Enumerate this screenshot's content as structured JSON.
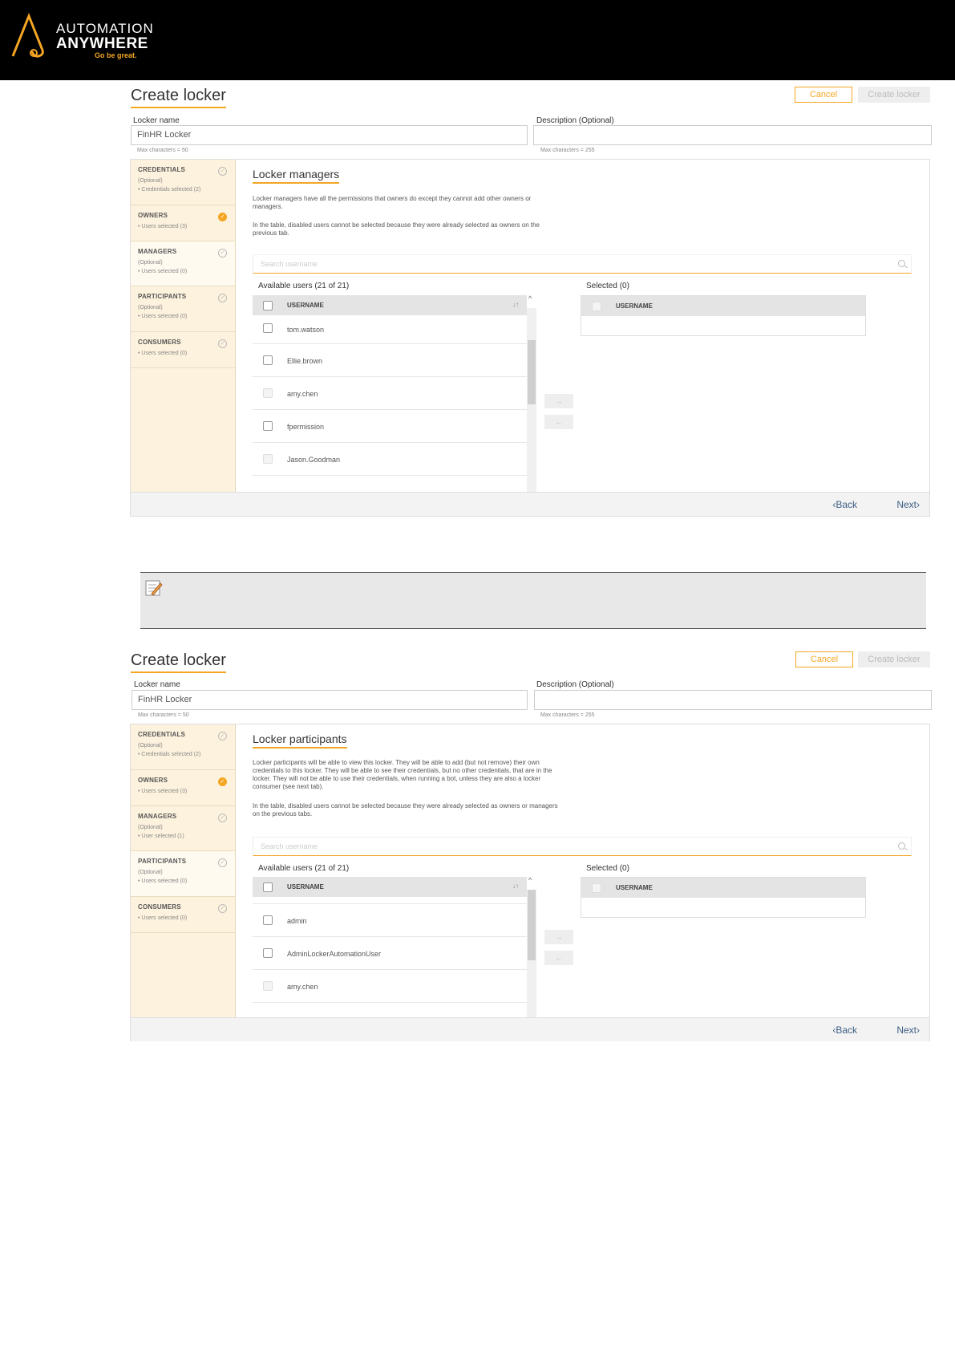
{
  "brand": {
    "line1": "AUTOMATION",
    "line2": "ANYWHERE",
    "tagline": "Go be great."
  },
  "panels": [
    {
      "title": "Create locker",
      "cancel_label": "Cancel",
      "create_label": "Create locker",
      "locker_name_label": "Locker name",
      "locker_name_value": "FinHR Locker",
      "locker_name_hint": "Max characters = 50",
      "description_label": "Description (Optional)",
      "description_value": "",
      "description_hint": "Max characters = 255",
      "steps": [
        {
          "name": "CREDENTIALS",
          "sub1": "(Optional)",
          "sub2": "• Credentials selected (2)",
          "done": false
        },
        {
          "name": "OWNERS",
          "sub1": "",
          "sub2": "• Users selected (3)",
          "done": true
        },
        {
          "name": "MANAGERS",
          "sub1": "(Optional)",
          "sub2": "• Users selected (0)",
          "done": false
        },
        {
          "name": "PARTICIPANTS",
          "sub1": "(Optional)",
          "sub2": "• Users selected (0)",
          "done": false
        },
        {
          "name": "CONSUMERS",
          "sub1": "",
          "sub2": "• Users selected (0)",
          "done": false
        }
      ],
      "section_title": "Locker managers",
      "desc1": "Locker managers have all the permissions that owners do except they cannot add other owners or managers.",
      "desc2": "In the table, disabled users cannot be selected because they were already selected as owners on the previous tab.",
      "search_placeholder": "Search username",
      "available_label": "Available users (21 of 21)",
      "selected_label": "Selected (0)",
      "column_username": "USERNAME",
      "users": [
        {
          "name": "tom.watson",
          "disabled": false
        },
        {
          "name": "Ellie.brown",
          "disabled": false
        },
        {
          "name": "amy.chen",
          "disabled": true
        },
        {
          "name": "fpermission",
          "disabled": false
        },
        {
          "name": "Jason.Goodman",
          "disabled": true
        }
      ],
      "move_right": "→",
      "move_left": "←",
      "back_label": "Back",
      "next_label": "Next"
    },
    {
      "title": "Create locker",
      "cancel_label": "Cancel",
      "create_label": "Create locker",
      "locker_name_label": "Locker name",
      "locker_name_value": "FinHR Locker",
      "locker_name_hint": "Max characters = 50",
      "description_label": "Description (Optional)",
      "description_value": "",
      "description_hint": "Max characters = 255",
      "steps": [
        {
          "name": "CREDENTIALS",
          "sub1": "(Optional)",
          "sub2": "• Credentials selected (2)",
          "done": false
        },
        {
          "name": "OWNERS",
          "sub1": "",
          "sub2": "• Users selected (3)",
          "done": true
        },
        {
          "name": "MANAGERS",
          "sub1": "(Optional)",
          "sub2": "• User selected (1)",
          "done": false
        },
        {
          "name": "PARTICIPANTS",
          "sub1": "(Optional)",
          "sub2": "• Users selected (0)",
          "done": false
        },
        {
          "name": "CONSUMERS",
          "sub1": "",
          "sub2": "• Users selected (0)",
          "done": false
        }
      ],
      "section_title": "Locker participants",
      "desc1": "Locker participants will be able to view this locker. They will be able to add (but not remove) their own credentials to this locker. They will be able to see their credentials, but no other credentials, that are in the locker. They will not be able to use their credentials, when running a bot, unless they are also a locker consumer (see next tab).",
      "desc2": "In the table, disabled users cannot be selected because they were already selected as owners or managers on the previous tabs.",
      "search_placeholder": "Search username",
      "available_label": "Available users (21 of 21)",
      "selected_label": "Selected (0)",
      "column_username": "USERNAME",
      "users": [
        {
          "name": "admin",
          "disabled": false
        },
        {
          "name": "AdminLockerAutomationUser",
          "disabled": false
        },
        {
          "name": "amy.chen",
          "disabled": true
        }
      ],
      "move_right": "→",
      "move_left": "←",
      "back_label": "Back",
      "next_label": "Next"
    }
  ],
  "icons": {
    "logo": "automation-anywhere-logo",
    "note": "note-pencil-icon",
    "check": "check-circle-icon",
    "search": "search-icon"
  },
  "colors": {
    "accent": "#f5a623",
    "steps_bg": "#fdf2dd",
    "link": "#3b5f84"
  }
}
